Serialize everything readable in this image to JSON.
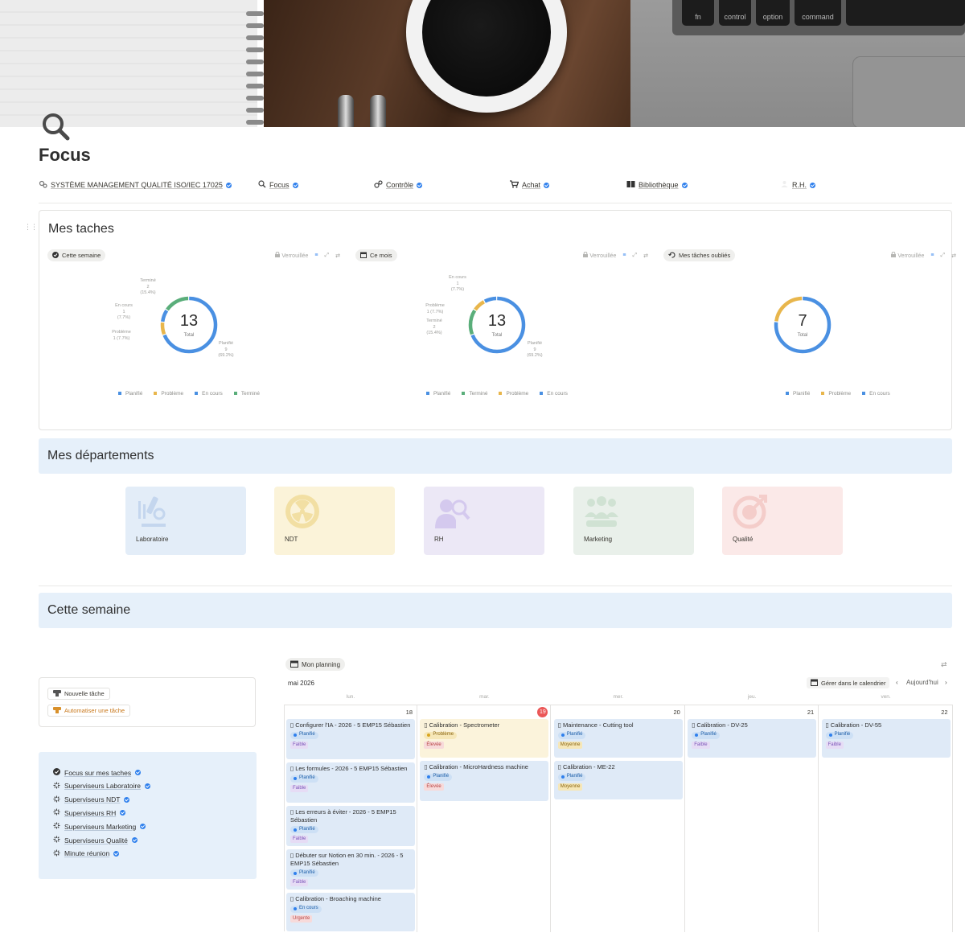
{
  "cover": {
    "keys": [
      "fn",
      "control",
      "option",
      "command"
    ]
  },
  "page": {
    "title": "Focus",
    "icon": "search-icon"
  },
  "nav": [
    {
      "label": "SYSTÈME MANAGEMENT QUALITÉ ISO/IEC 17025",
      "icon": "gears-icon"
    },
    {
      "label": "Focus",
      "icon": "search-icon"
    },
    {
      "label": "Contrôle",
      "icon": "check-gear-icon"
    },
    {
      "label": "Achat",
      "icon": "cart-icon"
    },
    {
      "label": "Bibliothèque",
      "icon": "book-icon"
    },
    {
      "label": "R.H.",
      "icon": "people-icon"
    }
  ],
  "tasks": {
    "title": "Mes taches",
    "locked_label": "Verrouillée",
    "widgets": [
      {
        "tab": "Cette semaine",
        "tab_icon": "check-circle-icon",
        "total": "13",
        "total_label": "Total",
        "labels": [
          {
            "name": "Terminé",
            "count": "2",
            "pct": "(15.4%)"
          },
          {
            "name": "En cours",
            "count": "1",
            "pct": "(7.7%)"
          },
          {
            "name": "Problème",
            "count": "1 (7.7%)",
            "pct": ""
          },
          {
            "name": "Planifié",
            "count": "9",
            "pct": "(69.2%)"
          }
        ],
        "legend": [
          "Planifié",
          "Problème",
          "En cours",
          "Terminé"
        ],
        "slices": [
          {
            "status": "Planifié",
            "value": 9,
            "color": "#4a90e2"
          },
          {
            "status": "Problème",
            "value": 1,
            "color": "#e8b64c"
          },
          {
            "status": "En cours",
            "value": 1,
            "color": "#4a90e2"
          },
          {
            "status": "Terminé",
            "value": 2,
            "color": "#5aae7a"
          }
        ]
      },
      {
        "tab": "Ce mois",
        "tab_icon": "calendar-icon",
        "total": "13",
        "total_label": "Total",
        "labels": [
          {
            "name": "En cours",
            "count": "1",
            "pct": "(7.7%)"
          },
          {
            "name": "Problème",
            "count": "1 (7.7%)",
            "pct": ""
          },
          {
            "name": "Terminé",
            "count": "2",
            "pct": "(15.4%)"
          },
          {
            "name": "Planifié",
            "count": "9",
            "pct": "(69.2%)"
          }
        ],
        "legend": [
          "Planifié",
          "Terminé",
          "Problème",
          "En cours"
        ],
        "slices": [
          {
            "status": "Planifié",
            "value": 9,
            "color": "#4a90e2"
          },
          {
            "status": "Terminé",
            "value": 2,
            "color": "#5aae7a"
          },
          {
            "status": "Problème",
            "value": 1,
            "color": "#e8b64c"
          },
          {
            "status": "En cours",
            "value": 1,
            "color": "#4a90e2"
          }
        ]
      },
      {
        "tab": "Mes tâches oubliés",
        "tab_icon": "history-icon",
        "total": "7",
        "total_label": "Total",
        "labels": [],
        "legend": [
          "Planifié",
          "Problème",
          "En cours"
        ],
        "slices": [
          {
            "status": "Planifié",
            "value": 5.4,
            "color": "#4a90e2"
          },
          {
            "status": "Problème",
            "value": 1.6,
            "color": "#e8b64c"
          }
        ]
      }
    ],
    "legend_colors": {
      "Planifié": "#4a90e2",
      "Problème": "#e8b64c",
      "En cours": "#4a90e2",
      "Terminé": "#5aae7a"
    }
  },
  "departments": {
    "title": "Mes départements",
    "items": [
      {
        "label": "Laboratoire",
        "icon": "microscope-icon",
        "bg": "#e3edf8",
        "fg": "#c4d6ee"
      },
      {
        "label": "NDT",
        "icon": "radiation-icon",
        "bg": "#fbf3d9",
        "fg": "#f2dfa3"
      },
      {
        "label": "RH",
        "icon": "person-search-icon",
        "bg": "#ece8f6",
        "fg": "#d4c9ee"
      },
      {
        "label": "Marketing",
        "icon": "team-icon",
        "bg": "#e9f0ea",
        "fg": "#d0e2d3"
      },
      {
        "label": "Qualité",
        "icon": "target-icon",
        "bg": "#fbe9e8",
        "fg": "#f4cdca"
      }
    ]
  },
  "week": {
    "title": "Cette semaine",
    "actions": [
      {
        "label": "Nouvelle tâche",
        "icon": "template-icon"
      },
      {
        "label": "Automatiser une tâche",
        "icon": "template-icon"
      }
    ],
    "links": [
      {
        "label": "Focus sur mes taches",
        "icon": "check-circle-icon"
      },
      {
        "label": "Superviseurs Laboratoire",
        "icon": "spark-icon"
      },
      {
        "label": "Superviseurs NDT",
        "icon": "spark-icon"
      },
      {
        "label": "Superviseurs RH",
        "icon": "spark-icon"
      },
      {
        "label": "Superviseurs Marketing",
        "icon": "spark-icon"
      },
      {
        "label": "Superviseurs Qualité",
        "icon": "spark-icon"
      },
      {
        "label": "Minute réunion",
        "icon": "spark-icon"
      }
    ]
  },
  "calendar": {
    "tab": "Mon planning",
    "month": "mai 2026",
    "manage": "Gérer dans le calendrier",
    "today": "Aujourd'hui",
    "days": [
      {
        "name": "lun.",
        "num": "18",
        "today": false
      },
      {
        "name": "mar.",
        "num": "19",
        "today": true
      },
      {
        "name": "mer.",
        "num": "20",
        "today": false
      },
      {
        "name": "jeu.",
        "num": "21",
        "today": false
      },
      {
        "name": "ven.",
        "num": "22",
        "today": false
      }
    ],
    "events": [
      [
        {
          "title": "Configurer l'IA - 2026 - 5 EMP15 Sébastien",
          "status": "Planifié",
          "priority": "Faible"
        },
        {
          "title": "Les formules - 2026 - 5 EMP15 Sébastien",
          "status": "Planifié",
          "priority": "Faible"
        },
        {
          "title": "Les erreurs à éviter - 2026 - 5 EMP15 Sébastien",
          "status": "Planifié",
          "priority": "Faible"
        },
        {
          "title": "Débuter sur Notion en 30 min. - 2026 - 5 EMP15 Sébastien",
          "status": "Planifié",
          "priority": "Faible"
        },
        {
          "title": "Calibration - Broaching machine",
          "status": "En cours",
          "priority": "Urgente"
        }
      ],
      [
        {
          "title": "Calibration - Spectrometer",
          "status": "Problème",
          "priority": "Élevée",
          "yellow": true
        },
        {
          "title": "Calibration - MicroHardness machine",
          "status": "Planifié",
          "priority": "Élevée"
        }
      ],
      [
        {
          "title": "Maintenance - Cutting tool",
          "status": "Planifié",
          "priority": "Moyenne"
        },
        {
          "title": "Calibration - ME-22",
          "status": "Planifié",
          "priority": "Moyenne"
        }
      ],
      [
        {
          "title": "Calibration - DV-25",
          "status": "Planifié",
          "priority": "Faible"
        }
      ],
      [
        {
          "title": "Calibration - DV-55",
          "status": "Planifié",
          "priority": "Faible"
        }
      ]
    ],
    "status_colors": {
      "Planifié": {
        "bg": "#cde0f5",
        "dot": "#2f80ed",
        "fg": "#1f5fa8"
      },
      "Problème": {
        "bg": "#f6e7b8",
        "dot": "#d9a520",
        "fg": "#8a6512"
      },
      "En cours": {
        "bg": "#cde0f5",
        "dot": "#2f80ed",
        "fg": "#1f5fa8"
      }
    },
    "priority_colors": {
      "Faible": {
        "bg": "#e6dcf5",
        "fg": "#7a55b8"
      },
      "Élevée": {
        "bg": "#f7dada",
        "fg": "#b84747"
      },
      "Moyenne": {
        "bg": "#f6e7b8",
        "fg": "#8a6512"
      },
      "Urgente": {
        "bg": "#f7dada",
        "fg": "#b84747"
      }
    }
  }
}
